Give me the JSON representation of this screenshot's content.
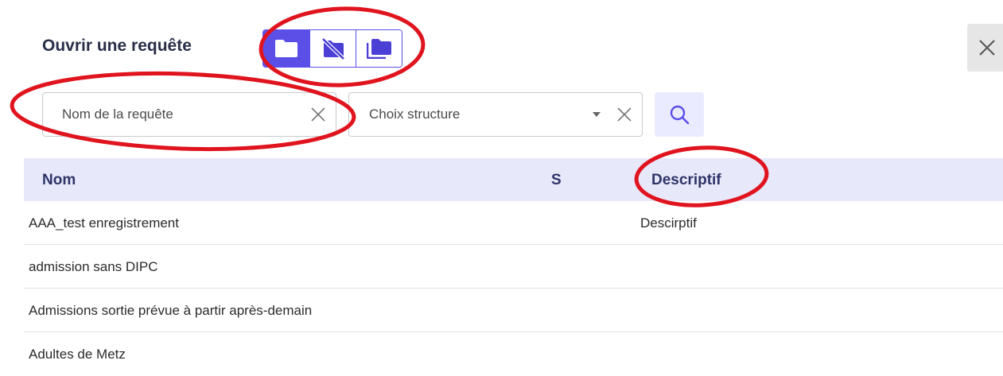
{
  "dialog": {
    "title": "Ouvrir une requête"
  },
  "view_toggle": [
    {
      "icon": "folder-icon",
      "active": true
    },
    {
      "icon": "folder-off-icon",
      "active": false
    },
    {
      "icon": "folders-icon",
      "active": false
    }
  ],
  "filters": {
    "name": {
      "value": "Nom de la requête"
    },
    "structure": {
      "value": "Choix structure"
    }
  },
  "table": {
    "columns": [
      "Nom",
      "S",
      "Descriptif"
    ],
    "rows": [
      {
        "name": "AAA_test enregistrement",
        "s": "",
        "description": "Descirptif"
      },
      {
        "name": "admission sans DIPC",
        "s": "",
        "description": ""
      },
      {
        "name": "Admissions sortie prévue à partir après-demain",
        "s": "",
        "description": ""
      },
      {
        "name": "Adultes de Metz",
        "s": "",
        "description": ""
      }
    ]
  },
  "colors": {
    "accent": "#5b4fe8",
    "header_bg": "#e8e8fb",
    "annotation": "#e0141e"
  }
}
